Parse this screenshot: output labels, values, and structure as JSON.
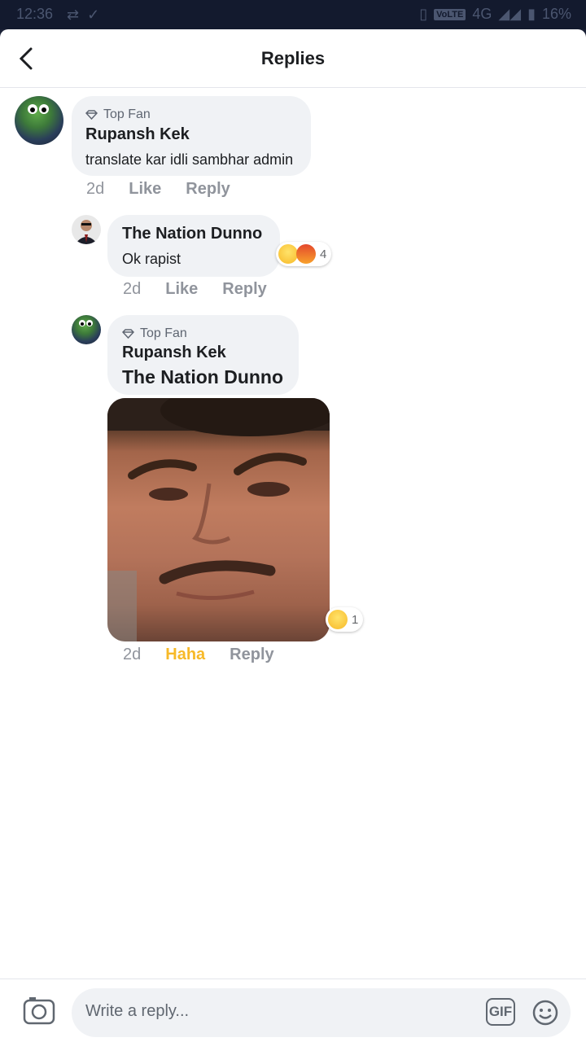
{
  "status_bar": {
    "time": "12:36",
    "network": "4G",
    "volte": "VoLTE",
    "battery": "16%"
  },
  "header": {
    "title": "Replies"
  },
  "comments": [
    {
      "badge": "Top Fan",
      "author": "Rupansh Kek",
      "text": "translate kar idli sambhar admin",
      "time": "2d",
      "like": "Like",
      "reply": "Reply"
    },
    {
      "author": "The Nation Dunno",
      "text": "Ok rapist",
      "time": "2d",
      "like": "Like",
      "reply": "Reply",
      "reactions": {
        "icons": [
          "haha-icon",
          "angry-icon"
        ],
        "count": "4"
      }
    },
    {
      "badge": "Top Fan",
      "author": "Rupansh Kek",
      "mention": "The Nation Dunno",
      "time": "2d",
      "like": "Haha",
      "reply": "Reply",
      "reactions": {
        "icons": [
          "haha-icon"
        ],
        "count": "1"
      }
    }
  ],
  "composer": {
    "placeholder": "Write a reply...",
    "gif": "GIF"
  },
  "colors": {
    "accent_haha": "#f7b928",
    "bubble": "#f0f2f5",
    "muted": "#90949c"
  }
}
